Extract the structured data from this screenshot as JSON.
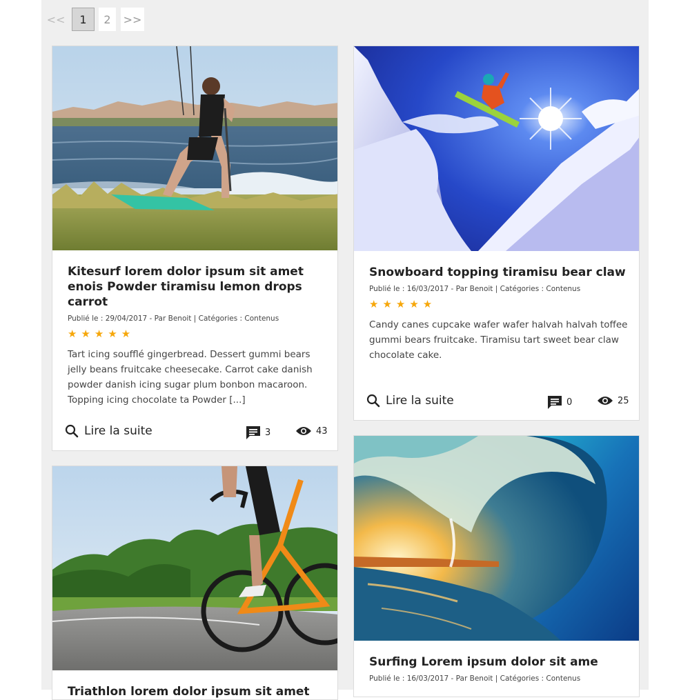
{
  "pagination": {
    "prev": "<<",
    "pages": [
      "1",
      "2"
    ],
    "active_page": "1",
    "next": ">>"
  },
  "posts": [
    {
      "title": "Kitesurf lorem dolor ipsum sit amet enois Powder tiramisu lemon drops carrot",
      "meta": "Publié le : 29/04/2017 - Par Benoit | Catégories : Contenus",
      "rating": 5,
      "stars": "★★★★★",
      "excerpt": "Tart icing soufflé gingerbread. Dessert gummi bears jelly beans fruitcake cheesecake. Carrot cake danish powder danish icing sugar plum bonbon macaroon. Topping icing chocolate ta Powder [...]",
      "read_more": "Lire la suite",
      "comments": "3",
      "views": "43",
      "image": "kitesurf-photo"
    },
    {
      "title": "Snowboard topping tiramisu bear claw",
      "meta": "Publié le : 16/03/2017 - Par Benoit | Catégories : Contenus",
      "rating": 5,
      "stars": "★★★★★",
      "excerpt": "Candy canes cupcake wafer wafer halvah halvah toffee gummi bears fruitcake. Tiramisu tart sweet bear claw chocolate cake.",
      "read_more": "Lire la suite",
      "comments": "0",
      "views": "25",
      "image": "snowboard-photo"
    },
    {
      "title": "Triathlon lorem dolor ipsum sit amet",
      "image": "cycling-photo"
    },
    {
      "title": "Surfing Lorem ipsum dolor sit ame",
      "meta": "Publié le : 16/03/2017 - Par Benoit | Catégories : Contenus",
      "image": "wave-photo"
    }
  ],
  "icons": {
    "search": "search-icon",
    "comments": "comment-icon",
    "views": "eye-icon"
  },
  "colors": {
    "star": "#f6a70b",
    "page_bg": "#efefef",
    "card_bg": "#ffffff",
    "text": "#222222"
  }
}
